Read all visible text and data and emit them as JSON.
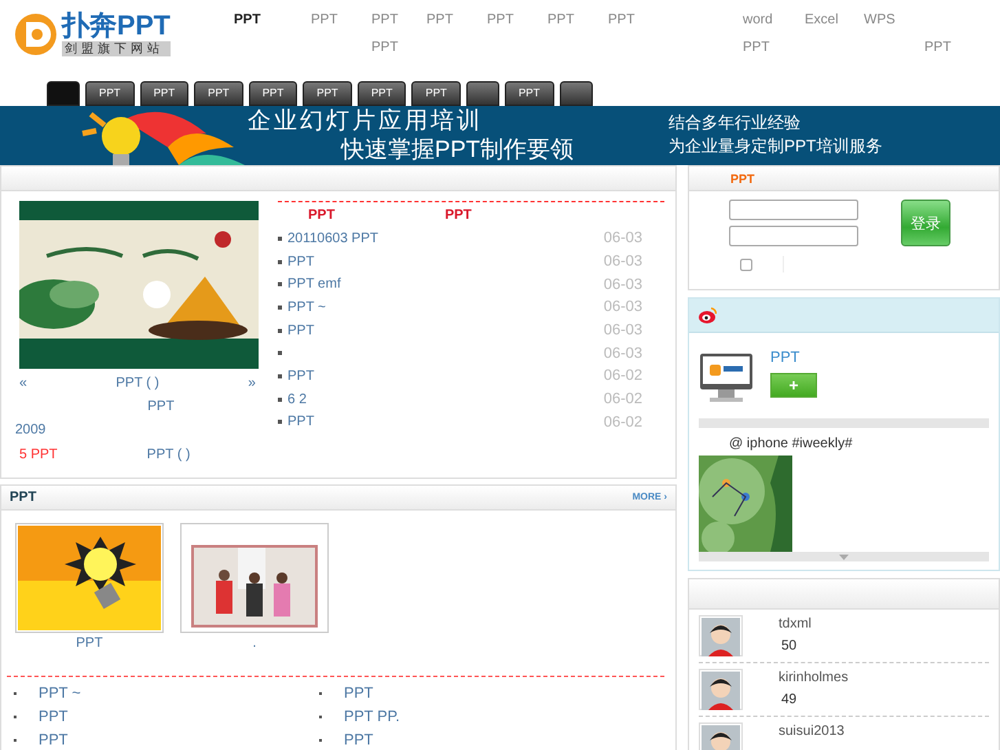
{
  "logo": {
    "name": "扑奔PPT",
    "tagline": "剑盟旗下网站"
  },
  "top_links": [
    {
      "label": "PPT",
      "selected": true
    },
    {
      "label": "PPT",
      "selected": false
    },
    {
      "label": "PPT",
      "sub": "PPT",
      "selected": false
    },
    {
      "label": "PPT",
      "selected": false
    },
    {
      "label": "PPT",
      "selected": false
    },
    {
      "label": "PPT",
      "selected": false
    },
    {
      "label": "PPT",
      "selected": false
    },
    {
      "label": "word",
      "sub": "PPT",
      "selected": false
    },
    {
      "label": "Excel",
      "selected": false
    },
    {
      "label": "WPS",
      "selected": false
    },
    {
      "sub": "PPT",
      "selected": false
    }
  ],
  "tabs": [
    {
      "selected": true
    },
    {
      "label": "PPT",
      "selected": false
    },
    {
      "label": "PPT",
      "selected": false
    },
    {
      "label": "PPT",
      "selected": false
    },
    {
      "label": "PPT",
      "selected": false
    },
    {
      "label": "PPT",
      "selected": false
    },
    {
      "label": "PPT",
      "selected": false
    },
    {
      "label": "PPT",
      "selected": false
    },
    {
      "selected": false
    },
    {
      "label": "PPT",
      "selected": false
    },
    {
      "selected": false
    }
  ],
  "banner": {
    "left": [
      "企业幻灯片应用培训",
      "快速掌握PPT制作要领"
    ],
    "right": [
      "结合多年行业经验",
      "为企业量身定制PPT培训服务"
    ]
  },
  "news": {
    "featured": {
      "prev": "«",
      "caption": "PPT ( )",
      "next": "»"
    },
    "notes": [
      [
        {
          "text": "PPT",
          "kind": "link"
        }
      ],
      [
        {
          "text": "2009",
          "kind": "link"
        }
      ],
      [
        {
          "text": "5 PPT",
          "kind": "hot"
        },
        {
          "text": "PPT ( )",
          "kind": "link"
        }
      ]
    ],
    "headlines": [
      "PPT",
      "PPT"
    ],
    "items": [
      {
        "text": "20110603 PPT",
        "date": "06-03"
      },
      {
        "text": "PPT",
        "date": "06-03"
      },
      {
        "text": "PPT emf",
        "date": "06-03"
      },
      {
        "text": "PPT ~",
        "date": "06-03"
      },
      {
        "text": "PPT",
        "date": "06-03"
      },
      {
        "date": "06-03"
      },
      {
        "text": "PPT",
        "date": "06-02"
      },
      {
        "text": "6 2",
        "date": "06-02"
      },
      {
        "text": "PPT",
        "date": "06-02"
      }
    ]
  },
  "gallery": {
    "title": "PPT",
    "more": "MORE ›",
    "thumbs": [
      {
        "caption": "PPT"
      },
      {
        "caption": "."
      }
    ],
    "list": [
      [
        "PPT ~",
        "PPT",
        "PPT"
      ],
      [
        "PPT",
        "PPT PP.",
        "PPT"
      ]
    ]
  },
  "login": {
    "title": "PPT",
    "remember": {
      "checked": false
    },
    "button": "登录"
  },
  "weibo": {
    "name": "PPT",
    "follow": "+",
    "post": "@ iphone #iweekly#"
  },
  "members": [
    {
      "name": "tdxml",
      "count": "50"
    },
    {
      "name": "kirinholmes",
      "count": "49"
    },
    {
      "name": "suisui2013"
    }
  ]
}
